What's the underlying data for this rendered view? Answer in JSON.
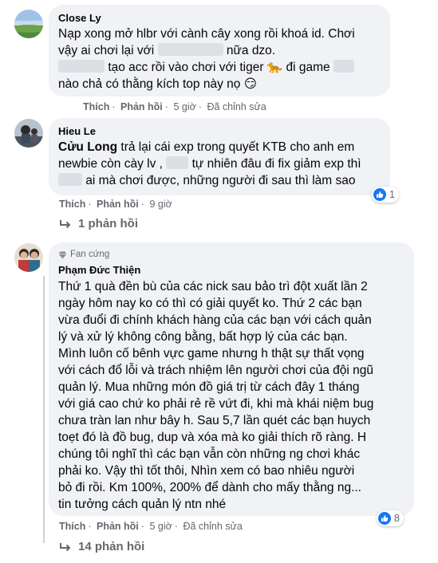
{
  "comments": [
    {
      "author": "Close Ly",
      "line1": "Nạp xong mở hlbr với cành cây xong rồi khoá id. Chơi",
      "line2a": "vậy ai chơi lại với",
      "line2b": "nữa dzo.",
      "line3a": "tạo acc rồi vào chơi với tiger",
      "line3b": "đi game",
      "line4": "nào chả có thằng kích top này nọ",
      "emoji_tiger": "🐆",
      "emoji_face": "😏",
      "action_like": "Thích",
      "action_reply": "Phản hồi",
      "time": "5 giờ",
      "edited": "Đã chỉnh sửa"
    },
    {
      "author": "Hieu Le",
      "mention": "Cửu Long",
      "line1_rest": "trả lại cái exp trong quyết KTB cho anh em",
      "line2a": "newbie còn cày lv ,",
      "line2b": "tự nhiên đâu đi fix giảm exp thì",
      "line3": "ai mà chơi được, những người đi sau thì làm sao",
      "action_like": "Thích",
      "action_reply": "Phản hồi",
      "time": "9 giờ",
      "reaction_count": "1",
      "replies": "1 phản hồi"
    },
    {
      "badge": "Fan cứng",
      "author": "Phạm Đức Thiện",
      "lines": [
        "Thứ 1 quà đền bù của các nick sau bảo trì đột xuất lần 2",
        "ngày hôm nay ko có thì có giải quyết ko. Thứ 2 các bạn",
        "vừa đuổi đi chính khách hàng của các bạn với cách quản",
        "lý và xử lý không công bằng, bất hợp lý của các bạn.",
        "Mình luôn cố bênh vực game nhưng h thật sự thất vọng",
        "với cách đổ lỗi và trách nhiệm lên người chơi của đội ngũ",
        "quản lý. Mua những món đồ giá trị từ cách đây 1 tháng",
        "với giá cao chứ ko phải rẻ rề vứt đi, khi mà khái niệm bug",
        "chưa tràn lan như bây h. Sau 5,7 lần quét các bạn huych",
        "toẹt đó là đồ bug, dup và xóa mà ko giải thích rõ ràng. H",
        "chúng tôi nghĩ thì các bạn vẫn còn những ng chơi khác",
        "phải ko. Vậy thì tốt thôi, Nhìn xem có bao nhiêu người",
        "bỏ đi rồi. Km 100%, 200% để dành cho mấy thằng ng...",
        "tin tưởng cách quản lý ntn nhé"
      ],
      "action_like": "Thích",
      "action_reply": "Phản hồi",
      "time": "5 giờ",
      "edited": "Đã chỉnh sửa",
      "reaction_count": "8",
      "replies": "14 phản hồi"
    }
  ],
  "icons": {
    "reply_arrow": "reply-arrow-icon",
    "like": "like-icon",
    "diamond": "diamond-badge-icon"
  },
  "colors": {
    "bubble": "#f0f2f5",
    "secondary_text": "#65676b",
    "like_blue": "#1877f2"
  }
}
